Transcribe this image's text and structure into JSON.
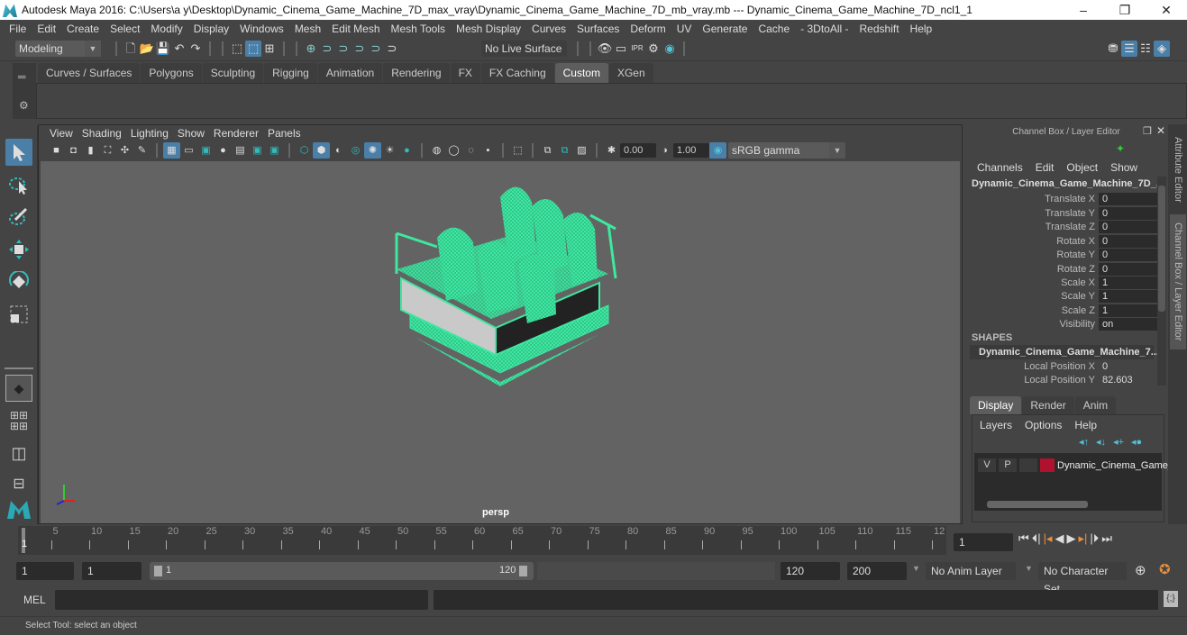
{
  "window": {
    "title": "Autodesk Maya 2016: C:\\Users\\a y\\Desktop\\Dynamic_Cinema_Game_Machine_7D_max_vray\\Dynamic_Cinema_Game_Machine_7D_mb_vray.mb  ---  Dynamic_Cinema_Game_Machine_7D_ncl1_1",
    "minimize": "–",
    "restore": "❐",
    "close": "✕"
  },
  "menubar": [
    "File",
    "Edit",
    "Create",
    "Select",
    "Modify",
    "Display",
    "Windows",
    "Mesh",
    "Edit Mesh",
    "Mesh Tools",
    "Mesh Display",
    "Curves",
    "Surfaces",
    "Deform",
    "UV",
    "Generate",
    "Cache",
    "- 3DtoAll -",
    "Redshift",
    "Help"
  ],
  "statusline": {
    "mode": "Modeling",
    "live_surface": "No Live Surface"
  },
  "shelf": {
    "tabs": [
      "Curves / Surfaces",
      "Polygons",
      "Sculpting",
      "Rigging",
      "Animation",
      "Rendering",
      "FX",
      "FX Caching",
      "Custom",
      "XGen"
    ],
    "active_tab": "Custom"
  },
  "viewport": {
    "menu": [
      "View",
      "Shading",
      "Lighting",
      "Show",
      "Renderer",
      "Panels"
    ],
    "exposure": "0.00",
    "gamma": "1.00",
    "color_space": "sRGB gamma",
    "camera_label": "persp",
    "wireframe_color": "#3de8a0"
  },
  "channel_box": {
    "title": "Channel Box / Layer Editor",
    "menu": [
      "Channels",
      "Edit",
      "Object",
      "Show"
    ],
    "object_name": "Dynamic_Cinema_Game_Machine_7D_...",
    "attributes": [
      {
        "label": "Translate X",
        "value": "0"
      },
      {
        "label": "Translate Y",
        "value": "0"
      },
      {
        "label": "Translate Z",
        "value": "0"
      },
      {
        "label": "Rotate X",
        "value": "0"
      },
      {
        "label": "Rotate Y",
        "value": "0"
      },
      {
        "label": "Rotate Z",
        "value": "0"
      },
      {
        "label": "Scale X",
        "value": "1"
      },
      {
        "label": "Scale Y",
        "value": "1"
      },
      {
        "label": "Scale Z",
        "value": "1"
      },
      {
        "label": "Visibility",
        "value": "on"
      }
    ],
    "shapes_header": "SHAPES",
    "shape_name": "Dynamic_Cinema_Game_Machine_7...",
    "shape_attributes": [
      {
        "label": "Local Position X",
        "value": "0"
      },
      {
        "label": "Local Position Y",
        "value": "82.603"
      }
    ]
  },
  "layer_editor": {
    "tabs": [
      "Display",
      "Render",
      "Anim"
    ],
    "active_tab": "Display",
    "menu": [
      "Layers",
      "Options",
      "Help"
    ],
    "layer": {
      "v": "V",
      "p": "P",
      "color": "#b0112e",
      "name": "Dynamic_Cinema_Game_"
    }
  },
  "side_tabs": [
    "Attribute Editor",
    "Channel Box / Layer Editor"
  ],
  "timeline": {
    "ticks": [
      "5",
      "10",
      "15",
      "20",
      "25",
      "30",
      "35",
      "40",
      "45",
      "50",
      "55",
      "60",
      "65",
      "70",
      "75",
      "80",
      "85",
      "90",
      "95",
      "100",
      "105",
      "110",
      "115",
      "12"
    ],
    "current_marker": "1",
    "current_frame": "1"
  },
  "range": {
    "start": "1",
    "playback_start": "1",
    "slider_start": "1",
    "slider_end": "120",
    "playback_end": "120",
    "end": "200",
    "anim_layer": "No Anim Layer",
    "character_set": "No Character Set"
  },
  "command_line": {
    "label": "MEL"
  },
  "help_line": "Select Tool: select an object"
}
